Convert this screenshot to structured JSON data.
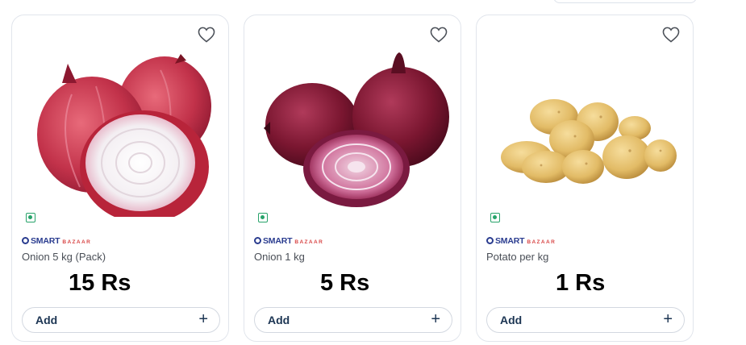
{
  "products": [
    {
      "name": "Onion 5 kg (Pack)",
      "brand_main": "SMART",
      "brand_sub": "BAZAAR",
      "price": "15 Rs",
      "add_label": "Add",
      "add_icon": "+",
      "image": "red-onion-halved-image",
      "veg_badge": "veg-indicator-icon"
    },
    {
      "name": "Onion 1 kg",
      "brand_main": "SMART",
      "brand_sub": "BAZAAR",
      "price": "5 Rs",
      "add_label": "Add",
      "add_icon": "+",
      "image": "purple-onion-halved-image",
      "veg_badge": "veg-indicator-icon"
    },
    {
      "name": "Potato per kg",
      "brand_main": "SMART",
      "brand_sub": "BAZAAR",
      "price": "1 Rs",
      "add_label": "Add",
      "add_icon": "+",
      "image": "potatoes-pile-image",
      "veg_badge": "veg-indicator-icon"
    }
  ],
  "colors": {
    "brand_blue": "#2a3c8f",
    "brand_red": "#d84646",
    "veg_green": "#27a36a",
    "button_text": "#1c3553",
    "card_border": "#e1e5ec"
  }
}
